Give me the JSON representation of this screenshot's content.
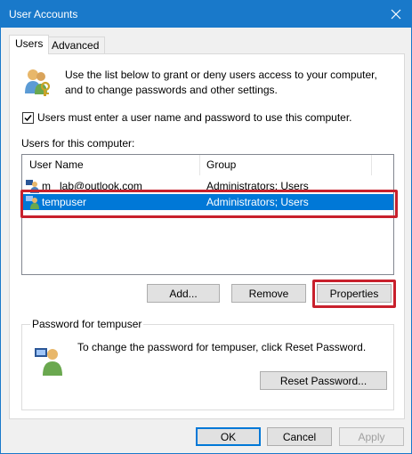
{
  "window": {
    "title": "User Accounts"
  },
  "tabs": [
    {
      "label": "Users",
      "active": true
    },
    {
      "label": "Advanced",
      "active": false
    }
  ],
  "intro": {
    "line1": "Use the list below to grant or deny users access to your computer,",
    "line2": "and to change passwords and other settings."
  },
  "checkbox": {
    "label": "Users must enter a user name and password to use this computer.",
    "checked": true
  },
  "users_label": "Users for this computer:",
  "table": {
    "columns": [
      "User Name",
      "Group"
    ],
    "rows": [
      {
        "name": "m_ lab@outlook.com",
        "group": "Administrators; Users",
        "selected": false
      },
      {
        "name": "tempuser",
        "group": "Administrators; Users",
        "selected": true
      }
    ]
  },
  "buttons": {
    "add": "Add...",
    "remove": "Remove",
    "properties": "Properties",
    "reset_password": "Reset Password...",
    "ok": "OK",
    "cancel": "Cancel",
    "apply": "Apply"
  },
  "password_group": {
    "legend": "Password for tempuser",
    "text": "To change the password for tempuser, click Reset Password."
  },
  "colors": {
    "titlebar": "#1979ca",
    "selection": "#0078d7",
    "highlight": "#c8202c"
  },
  "icons": {
    "intro": "users-key-icon",
    "password": "user-password-icon",
    "user_row": "user-icon",
    "close": "close-icon"
  }
}
